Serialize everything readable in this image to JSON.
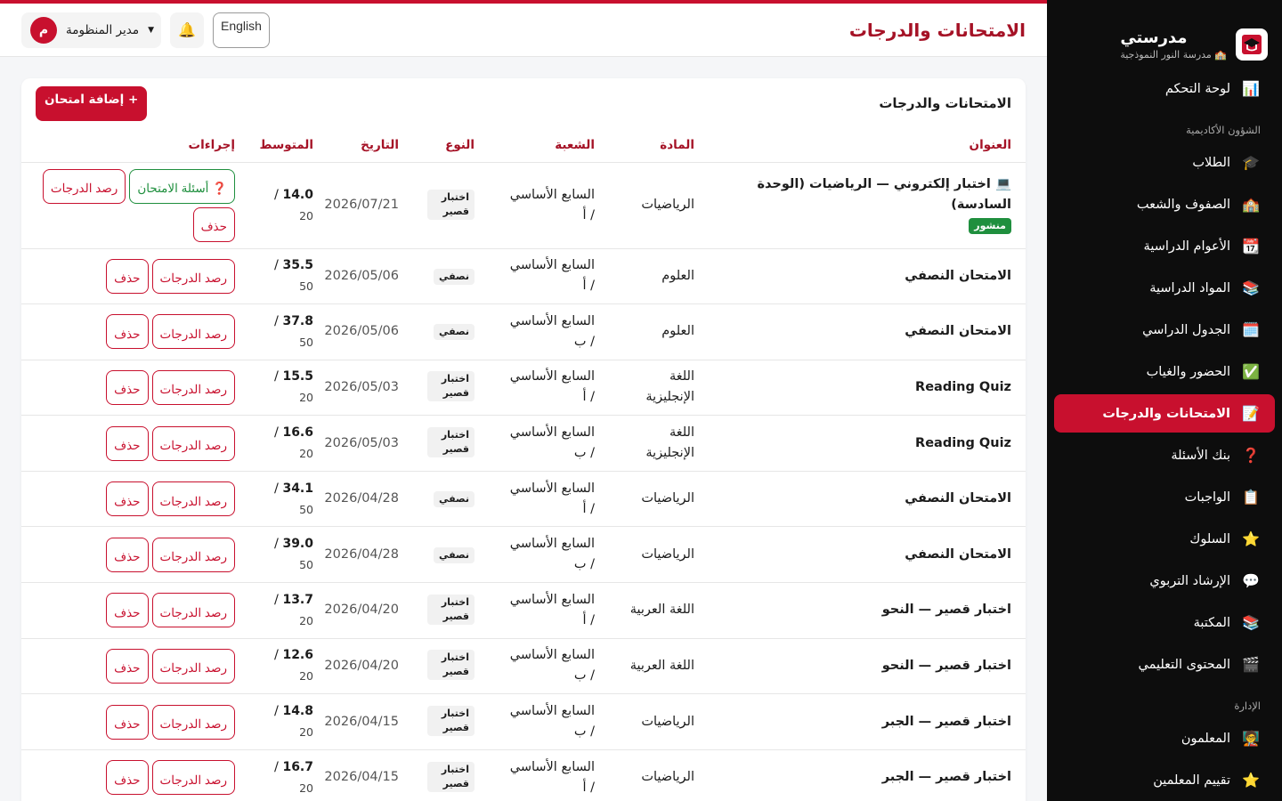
{
  "brand": {
    "name": "مدرستي",
    "school": "🏫 مدرسة النور النموذجية"
  },
  "sidebar": {
    "items": [
      {
        "label": "لوحة التحكم",
        "icon": "📊",
        "icon_name": "chart-icon"
      },
      {
        "section": "الشؤون الأكاديمية"
      },
      {
        "label": "الطلاب",
        "icon": "🎓",
        "icon_name": "graduation-cap-icon"
      },
      {
        "label": "الصفوف والشعب",
        "icon": "🏫",
        "icon_name": "school-icon"
      },
      {
        "label": "الأعوام الدراسية",
        "icon": "📆",
        "icon_name": "calendar-icon"
      },
      {
        "label": "المواد الدراسية",
        "icon": "📚",
        "icon_name": "books-icon"
      },
      {
        "label": "الجدول الدراسي",
        "icon": "🗓️",
        "icon_name": "schedule-icon"
      },
      {
        "label": "الحضور والغياب",
        "icon": "✅",
        "icon_name": "check-icon"
      },
      {
        "label": "الامتحانات والدرجات",
        "icon": "📝",
        "icon_name": "memo-icon",
        "active": true
      },
      {
        "label": "بنك الأسئلة",
        "icon": "❓",
        "icon_name": "question-icon"
      },
      {
        "label": "الواجبات",
        "icon": "📋",
        "icon_name": "clipboard-icon"
      },
      {
        "label": "السلوك",
        "icon": "⭐",
        "icon_name": "star-icon"
      },
      {
        "label": "الإرشاد التربوي",
        "icon": "💬",
        "icon_name": "speech-icon"
      },
      {
        "label": "المكتبة",
        "icon": "📚",
        "icon_name": "library-icon"
      },
      {
        "label": "المحتوى التعليمي",
        "icon": "🎬",
        "icon_name": "clapper-icon"
      },
      {
        "section": "الإدارة"
      },
      {
        "label": "المعلمون",
        "icon": "🧑‍🏫",
        "icon_name": "teacher-icon"
      },
      {
        "label": "تقييم المعلمين",
        "icon": "⭐",
        "icon_name": "star-icon"
      }
    ]
  },
  "topbar": {
    "title": "الامتحانات والدرجات",
    "user_initial": "م",
    "user_name": "مدير المنظومة",
    "bell": "🔔",
    "lang": "English"
  },
  "card": {
    "title": "الامتحانات والدرجات",
    "add_label": "+ إضافة امتحان"
  },
  "table": {
    "headers": {
      "title": "العنوان",
      "subject": "المادة",
      "section": "الشعبة",
      "type": "النوع",
      "date": "التاريخ",
      "avg": "المتوسط",
      "actions": "إجراءات"
    },
    "labels": {
      "grades": "رصد الدرجات",
      "delete": "حذف",
      "questions": "أسئلة الامتحان",
      "published": "منشور"
    },
    "rows": [
      {
        "title": "💻 اختبار إلكتروني — الرياضيات (الوحدة السادسة)",
        "published": true,
        "subject": "الرياضيات",
        "section": "السابع الأساسي / أ",
        "type": "اختبار قصير",
        "date": "2026/07/21",
        "avg": "14.0",
        "max": "20",
        "questions": true
      },
      {
        "title": "الامتحان النصفي",
        "subject": "العلوم",
        "section": "السابع الأساسي / أ",
        "type": "نصفي",
        "date": "2026/05/06",
        "avg": "35.5",
        "max": "50"
      },
      {
        "title": "الامتحان النصفي",
        "subject": "العلوم",
        "section": "السابع الأساسي / ب",
        "type": "نصفي",
        "date": "2026/05/06",
        "avg": "37.8",
        "max": "50"
      },
      {
        "title": "Reading Quiz",
        "subject": "اللغة الإنجليزية",
        "section": "السابع الأساسي / أ",
        "type": "اختبار قصير",
        "date": "2026/05/03",
        "avg": "15.5",
        "max": "20"
      },
      {
        "title": "Reading Quiz",
        "subject": "اللغة الإنجليزية",
        "section": "السابع الأساسي / ب",
        "type": "اختبار قصير",
        "date": "2026/05/03",
        "avg": "16.6",
        "max": "20"
      },
      {
        "title": "الامتحان النصفي",
        "subject": "الرياضيات",
        "section": "السابع الأساسي / أ",
        "type": "نصفي",
        "date": "2026/04/28",
        "avg": "34.1",
        "max": "50"
      },
      {
        "title": "الامتحان النصفي",
        "subject": "الرياضيات",
        "section": "السابع الأساسي / ب",
        "type": "نصفي",
        "date": "2026/04/28",
        "avg": "39.0",
        "max": "50"
      },
      {
        "title": "اختبار قصير — النحو",
        "subject": "اللغة العربية",
        "section": "السابع الأساسي / أ",
        "type": "اختبار قصير",
        "date": "2026/04/20",
        "avg": "13.7",
        "max": "20"
      },
      {
        "title": "اختبار قصير — النحو",
        "subject": "اللغة العربية",
        "section": "السابع الأساسي / ب",
        "type": "اختبار قصير",
        "date": "2026/04/20",
        "avg": "12.6",
        "max": "20"
      },
      {
        "title": "اختبار قصير — الجبر",
        "subject": "الرياضيات",
        "section": "السابع الأساسي / ب",
        "type": "اختبار قصير",
        "date": "2026/04/15",
        "avg": "14.8",
        "max": "20"
      },
      {
        "title": "اختبار قصير — الجبر",
        "subject": "الرياضيات",
        "section": "السابع الأساسي / أ",
        "type": "اختبار قصير",
        "date": "2026/04/15",
        "avg": "16.7",
        "max": "20"
      }
    ]
  },
  "colors": {
    "accent": "#c8102e",
    "title_red": "#a51226",
    "sidebar_bg": "#0d0d0d",
    "published_green": "#1f8f3e"
  }
}
